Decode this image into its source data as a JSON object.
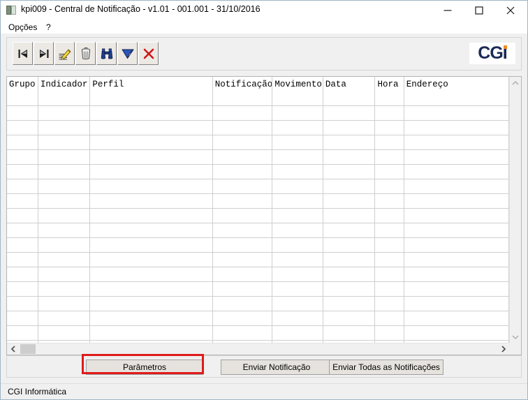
{
  "window": {
    "title": "kpi009 - Central de Notificação - v1.01 - 001.001 - 31/10/2016",
    "app_icon": "application-icon",
    "controls": {
      "minimize": "minimize-icon",
      "maximize": "maximize-icon",
      "close": "close-icon"
    }
  },
  "menubar": {
    "items": [
      {
        "label": "Opções",
        "name": "menu-opcoes"
      },
      {
        "label": "?",
        "name": "menu-help"
      }
    ]
  },
  "toolbar": {
    "buttons": [
      {
        "icon": "first-record-icon",
        "tooltip": "Primeiro"
      },
      {
        "icon": "last-record-icon",
        "tooltip": "Último"
      },
      {
        "icon": "edit-pencil-icon",
        "tooltip": "Editar"
      },
      {
        "icon": "delete-trash-icon",
        "tooltip": "Excluir"
      },
      {
        "icon": "find-binoculars-icon",
        "tooltip": "Pesquisar"
      },
      {
        "icon": "send-flag-icon",
        "tooltip": "Enviar"
      },
      {
        "icon": "cancel-x-icon",
        "tooltip": "Cancelar"
      }
    ],
    "logo": {
      "text": "CGI",
      "brand_color": "#1b2a56",
      "accent_color": "#f28c28"
    }
  },
  "grid": {
    "columns": [
      {
        "label": "Grupo",
        "width": 44
      },
      {
        "label": "Indicador",
        "width": 74
      },
      {
        "label": "Perfil",
        "width": 174
      },
      {
        "label": "Notificação",
        "width": 85
      },
      {
        "label": "Movimento",
        "width": 72
      },
      {
        "label": "Data",
        "width": 74
      },
      {
        "label": "Hora",
        "width": 41
      },
      {
        "label": "Endereço",
        "width": 149
      }
    ],
    "rows": [],
    "empty_row_count": 18,
    "scrollbars": {
      "vertical": {
        "up": "chevron-up-icon",
        "down": "chevron-down-icon"
      },
      "horizontal": {
        "left": "chevron-left-icon",
        "right": "chevron-right-icon"
      }
    }
  },
  "buttonbar": {
    "parametros": "Parâmetros",
    "enviar_notificacao": "Enviar Notificação",
    "enviar_todas": "Enviar Todas as Notificações"
  },
  "annotation": {
    "target": "parametros-button",
    "color": "#e01b1b"
  },
  "statusbar": {
    "text": "CGI Informática"
  }
}
